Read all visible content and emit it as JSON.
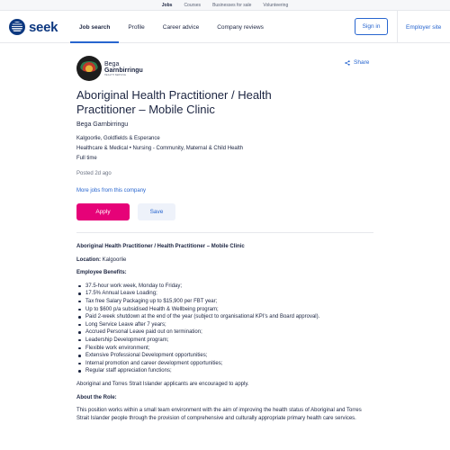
{
  "topbar": {
    "links": [
      "Jobs",
      "Courses",
      "Businesses for sale",
      "Volunteering"
    ]
  },
  "nav": {
    "logo": "seek",
    "links": [
      "Job search",
      "Profile",
      "Career advice",
      "Company reviews"
    ],
    "signin": "Sign in",
    "employer": "Employer site"
  },
  "company_logo": {
    "line1": "Bega",
    "line2": "Garnbirringu",
    "line3": "HEALTH SERVICE"
  },
  "job": {
    "share": "Share",
    "title": "Aboriginal Health Practitioner / Health Practitioner – Mobile Clinic",
    "company": "Bega Garnbirringu",
    "location": "Kalgoorlie, Goldfields & Esperance",
    "category": "Healthcare & Medical",
    "subcategory": "Nursing - Community, Maternal & Child Health",
    "worktype": "Full time",
    "posted": "Posted 2d ago",
    "more_jobs": "More jobs from this company",
    "apply": "Apply",
    "save": "Save"
  },
  "description": {
    "heading": "Aboriginal Health Practitioner / Health Practitioner – Mobile Clinic",
    "location_label": "Location:",
    "location_value": " Kalgoorlie",
    "benefits_heading": "Employee Benefits:",
    "benefits": [
      "37.5-hour work week, Monday to Friday;",
      "17.5% Annual Leave Loading;",
      "Tax free Salary Packaging up to $15,900 per FBT year;",
      "Up to $600 p/a subsidised Health & Wellbeing program;",
      "Paid 2-week shutdown at the end of the year (subject to organisational KPI's and Board approval).",
      "Long Service Leave after 7 years;",
      "Accrued Personal Leave paid out on termination;",
      "Leadership Development program;",
      "Flexible work environment;",
      "Extensive Professional Development opportunities;",
      "Internal promotion and career development opportunities;",
      "Regular staff appreciation functions;"
    ],
    "encourage": "Aboriginal and Torres Strait Islander applicants are encouraged to apply.",
    "about_heading": "About the Role:",
    "about_text": "This position works within a small team environment with the aim of improving the health status of Aboriginal and Torres Strait Islander people through the provision of comprehensive and culturally appropriate primary health care services."
  }
}
